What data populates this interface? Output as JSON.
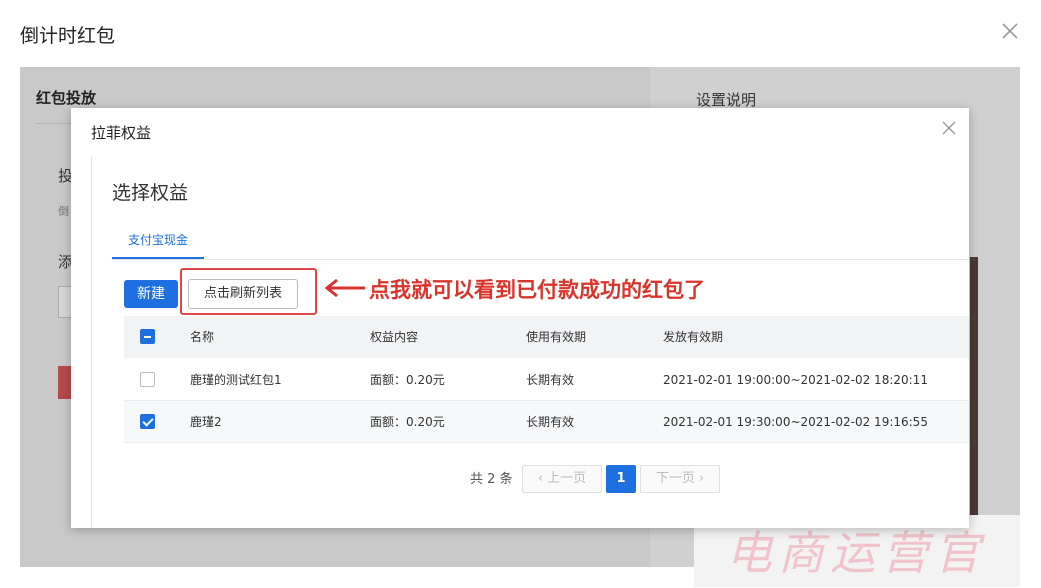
{
  "outer": {
    "title": "倒计时红包"
  },
  "background": {
    "left_title": "红包投放",
    "left_frag1": "投",
    "left_frag2": "倒",
    "left_frag3": "添",
    "right_title": "设置说明",
    "watermark": "电商运营官"
  },
  "modal": {
    "title": "拉菲权益",
    "section_title": "选择权益",
    "tab_label": "支付宝现金",
    "new_button": "新建",
    "refresh_button": "点击刷新列表",
    "annotation": "点我就可以看到已付款成功的红包了",
    "table": {
      "headers": [
        "名称",
        "权益内容",
        "使用有效期",
        "发放有效期"
      ],
      "rows": [
        {
          "name": "鹿瑾的测试红包1",
          "content": "面额：0.20元",
          "use_period": "长期有效",
          "issue_period": "2021-02-01 19:00:00~2021-02-02 18:20:11",
          "checked": false
        },
        {
          "name": "鹿瑾2",
          "content": "面额：0.20元",
          "use_period": "长期有效",
          "issue_period": "2021-02-01 19:30:00~2021-02-02 19:16:55",
          "checked": true
        }
      ]
    },
    "pagination": {
      "total": "共 2 条",
      "prev": "‹ 上一页",
      "current": "1",
      "next": "下一页 ›"
    }
  },
  "colors": {
    "primary": "#1e6fe0",
    "annotation_red": "#d9342b"
  }
}
